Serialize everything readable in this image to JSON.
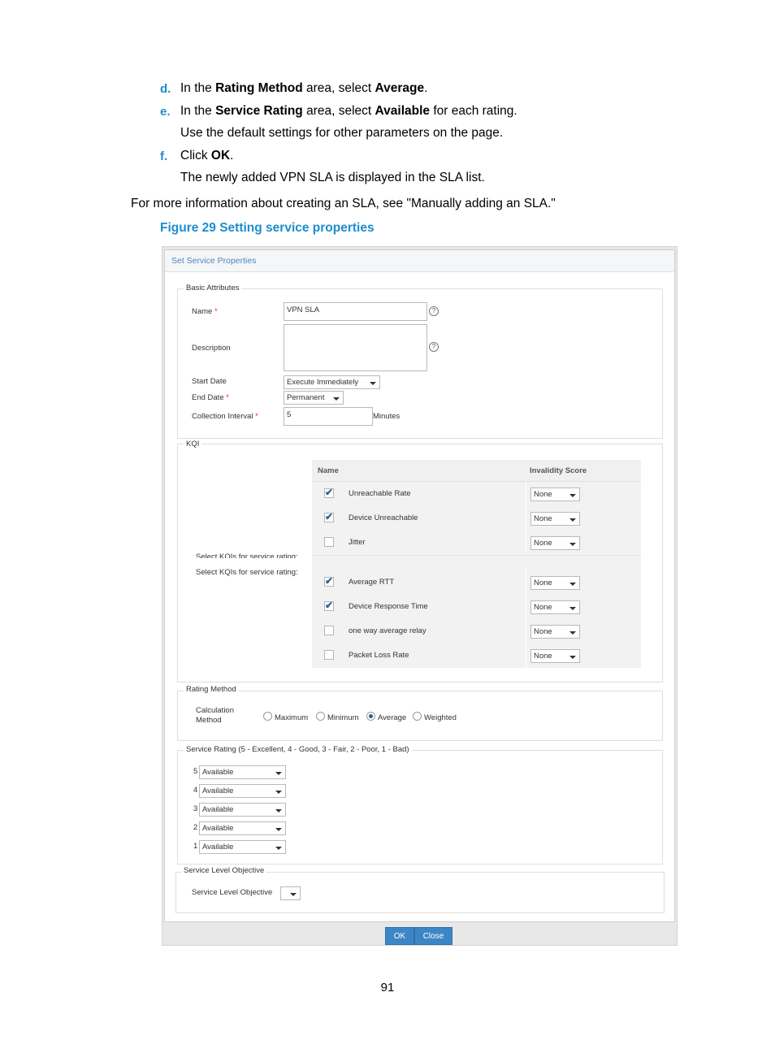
{
  "steps": [
    {
      "letter": "d.",
      "parts": [
        {
          "t": "In the ",
          "b": false
        },
        {
          "t": "Rating Method",
          "b": true
        },
        {
          "t": " area, select ",
          "b": false
        },
        {
          "t": "Average",
          "b": true
        },
        {
          "t": ".",
          "b": false
        }
      ]
    },
    {
      "letter": "e.",
      "parts": [
        {
          "t": "In the ",
          "b": false
        },
        {
          "t": "Service Rating",
          "b": true
        },
        {
          "t": " area, select ",
          "b": false
        },
        {
          "t": "Available",
          "b": true
        },
        {
          "t": " for each rating.",
          "b": false
        }
      ]
    },
    {
      "letter": "",
      "parts": [
        {
          "t": "Use the default settings for other parameters on the page.",
          "b": false
        }
      ]
    },
    {
      "letter": "f.",
      "parts": [
        {
          "t": "Click ",
          "b": false
        },
        {
          "t": "OK",
          "b": true
        },
        {
          "t": ".",
          "b": false
        }
      ]
    },
    {
      "letter": "",
      "parts": [
        {
          "t": "The newly added VPN SLA is displayed in the SLA list.",
          "b": false
        }
      ]
    }
  ],
  "more_info": "For more information about creating an SLA, see \"Manually adding an SLA.\"",
  "figure_caption": "Figure 29 Setting service properties",
  "dialog": {
    "title": "Set Service Properties",
    "basic": {
      "legend": "Basic Attributes",
      "name_label": "Name",
      "name_value": "VPN SLA",
      "description_label": "Description",
      "start_label": "Start Date",
      "start_value": "Execute Immediately",
      "end_label": "End Date",
      "end_value": "Permanent",
      "interval_label": "Collection Interval",
      "interval_value": "5",
      "interval_unit": "Minutes",
      "required_mark": "*",
      "help_glyph": "?"
    },
    "kqi": {
      "legend": "KQI",
      "select_label": "Select KQIs for service rating:",
      "col_name": "Name",
      "col_score": "Invalidity Score",
      "rows": [
        {
          "name": "Unreachable Rate",
          "checked": true,
          "score": "None"
        },
        {
          "name": "Device Unreachable",
          "checked": true,
          "score": "None"
        },
        {
          "name": "Jitter",
          "checked": false,
          "score": "None"
        },
        {
          "name": "Average RTT",
          "checked": true,
          "score": "None"
        },
        {
          "name": "Device Response Time",
          "checked": true,
          "score": "None"
        },
        {
          "name": "one way average relay",
          "checked": false,
          "score": "None"
        },
        {
          "name": "Packet Loss Rate",
          "checked": false,
          "score": "None"
        }
      ]
    },
    "rating": {
      "legend": "Rating Method",
      "calc_label_1": "Calculation",
      "calc_label_2": "Method",
      "options": [
        {
          "label": "Maximum",
          "selected": false
        },
        {
          "label": "Minimum",
          "selected": false
        },
        {
          "label": "Average",
          "selected": true
        },
        {
          "label": "Weighted",
          "selected": false
        }
      ]
    },
    "service_rating": {
      "legend": "Service Rating (5 - Excellent, 4 - Good, 3 - Fair, 2 - Poor, 1 - Bad)",
      "items": [
        {
          "level": "5",
          "value": "Available"
        },
        {
          "level": "4",
          "value": "Available"
        },
        {
          "level": "3",
          "value": "Available"
        },
        {
          "level": "2",
          "value": "Available"
        },
        {
          "level": "1",
          "value": "Available"
        }
      ]
    },
    "slo": {
      "legend": "Service Level Objective",
      "label": "Service Level Objective"
    },
    "ok_label": "OK",
    "close_label": "Close"
  },
  "page_number": "91"
}
